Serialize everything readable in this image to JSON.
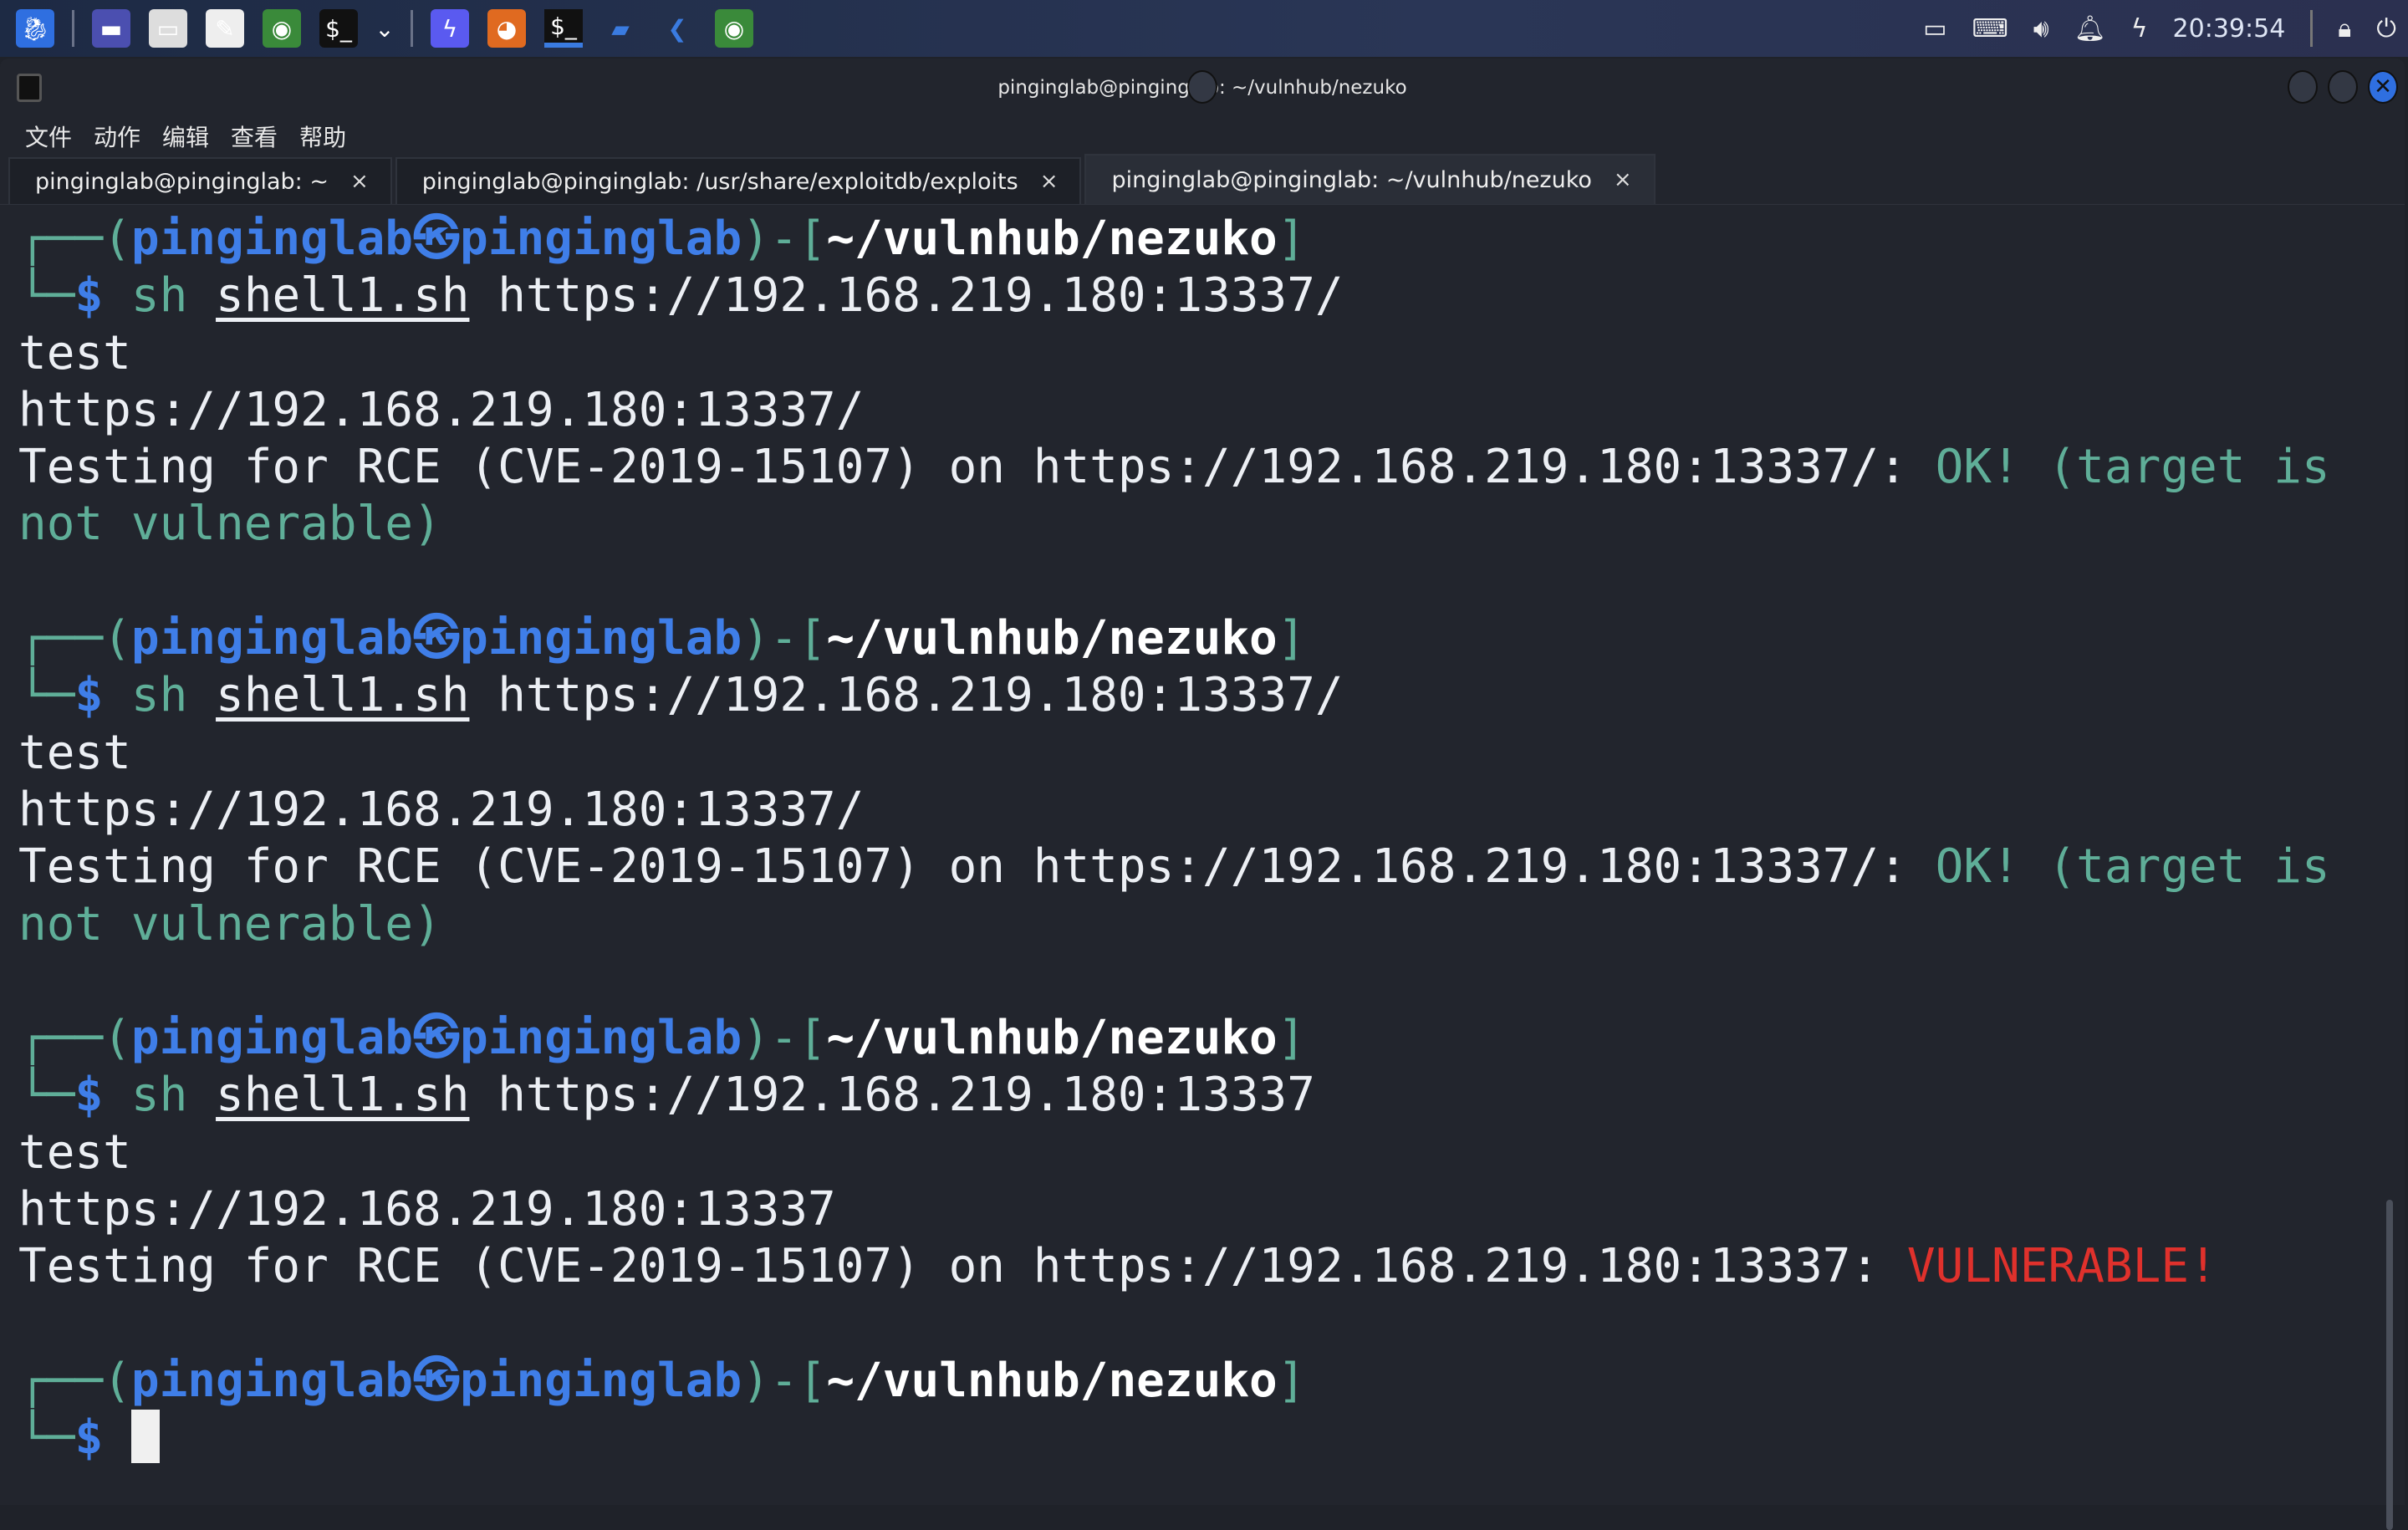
{
  "taskbar": {
    "apps": [
      "kali-menu-icon",
      "workspace-icon",
      "file-manager-icon",
      "text-editor-icon",
      "chrome-icon",
      "terminal-icon",
      "dropdown-icon",
      "burp-icon",
      "firefox-icon",
      "terminal-icon",
      "folder-icon",
      "vscode-icon",
      "chrome-icon"
    ],
    "clock": "20:39:54",
    "tray": [
      "network-icon",
      "keyboard-icon",
      "volume-icon",
      "bell-icon",
      "battery-icon",
      "lock-icon",
      "logout-icon"
    ]
  },
  "window": {
    "title": "pinginglab@pinginglab: ~/vulnhub/nezuko"
  },
  "menu": [
    "文件",
    "动作",
    "编辑",
    "查看",
    "帮助"
  ],
  "tabs": [
    {
      "label": "pinginglab@pinginglab: ~",
      "active": false
    },
    {
      "label": "pinginglab@pinginglab: /usr/share/exploitdb/exploits",
      "active": false
    },
    {
      "label": "pinginglab@pinginglab: ~/vulnhub/nezuko",
      "active": true
    }
  ],
  "tab_close": "×",
  "colors": {
    "prompt_user": "#3f7ee8",
    "prompt_frame": "#5fae98",
    "ok": "#5fae98",
    "vulnerable": "#e0312c",
    "background": "#22252d"
  },
  "terminal": {
    "prompt": {
      "frame_top": "┌──(",
      "user": "pinginglab㉿pinginglab",
      "mid": ")-[",
      "dir": "~/vulnhub/nezuko",
      "end": "]",
      "frame_bottom": "└─",
      "dollar": "$"
    },
    "blocks": [
      {
        "cmd": "sh",
        "arg": "shell1.sh",
        "url": "https://192.168.219.180:13337/",
        "out": [
          "test",
          "https://192.168.219.180:13337/"
        ],
        "test": "Testing for RCE (CVE-2019-15107) on https://192.168.219.180:13337/: ",
        "result": "OK! (target is",
        "result2": "not vulnerable)",
        "status": "ok"
      },
      {
        "cmd": "sh",
        "arg": "shell1.sh",
        "url": "https://192.168.219.180:13337/",
        "out": [
          "test",
          "https://192.168.219.180:13337/"
        ],
        "test": "Testing for RCE (CVE-2019-15107) on https://192.168.219.180:13337/: ",
        "result": "OK! (target is",
        "result2": "not vulnerable)",
        "status": "ok"
      },
      {
        "cmd": "sh",
        "arg": "shell1.sh",
        "url": "https://192.168.219.180:13337",
        "out": [
          "test",
          "https://192.168.219.180:13337"
        ],
        "test": "Testing for RCE (CVE-2019-15107) on https://192.168.219.180:13337: ",
        "result": "VULNERABLE!",
        "status": "vulnerable"
      }
    ]
  }
}
